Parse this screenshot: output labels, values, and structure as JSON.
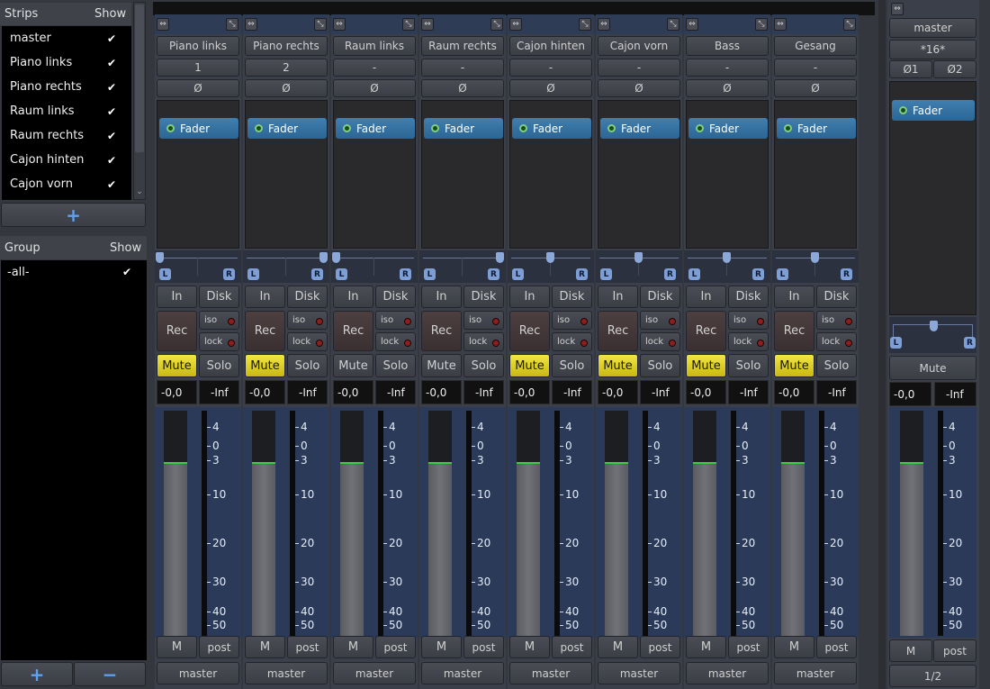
{
  "strips_panel": {
    "header": "Strips",
    "show_header": "Show",
    "items": [
      {
        "label": "master",
        "checked": true
      },
      {
        "label": "Piano links",
        "checked": true
      },
      {
        "label": "Piano rechts",
        "checked": true
      },
      {
        "label": "Raum links",
        "checked": true
      },
      {
        "label": "Raum rechts",
        "checked": true
      },
      {
        "label": "Cajon hinten",
        "checked": true
      },
      {
        "label": "Cajon vorn",
        "checked": true
      }
    ],
    "add": "+"
  },
  "group_panel": {
    "header": "Group",
    "show_header": "Show",
    "items": [
      {
        "label": "-all-",
        "checked": true
      }
    ],
    "add": "+",
    "remove": "−"
  },
  "check_glyph": "✔",
  "icons": {
    "width": "⇔",
    "shrink": "⤡"
  },
  "strips": [
    {
      "name": "Piano links",
      "input": "1",
      "phase": "Ø",
      "plugin": "Fader",
      "pan": -1,
      "in": "In",
      "disk": "Disk",
      "rec": "Rec",
      "iso": "iso",
      "lock": "lock",
      "mute": "Mute",
      "mute_active": true,
      "solo": "Solo",
      "gain": "-0,0",
      "peak": "-Inf",
      "meter_point": "post",
      "m": "M",
      "output": "master",
      "fader_level": 0.77
    },
    {
      "name": "Piano rechts",
      "input": "2",
      "phase": "Ø",
      "plugin": "Fader",
      "pan": 1,
      "in": "In",
      "disk": "Disk",
      "rec": "Rec",
      "iso": "iso",
      "lock": "lock",
      "mute": "Mute",
      "mute_active": true,
      "solo": "Solo",
      "gain": "-0,0",
      "peak": "-Inf",
      "meter_point": "post",
      "m": "M",
      "output": "master",
      "fader_level": 0.77
    },
    {
      "name": "Raum links",
      "input": "-",
      "phase": "Ø",
      "plugin": "Fader",
      "pan": -1,
      "in": "In",
      "disk": "Disk",
      "rec": "Rec",
      "iso": "iso",
      "lock": "lock",
      "mute": "Mute",
      "mute_active": false,
      "solo": "Solo",
      "gain": "-0,0",
      "peak": "-Inf",
      "meter_point": "post",
      "m": "M",
      "output": "master",
      "fader_level": 0.77
    },
    {
      "name": "Raum rechts",
      "input": "-",
      "phase": "Ø",
      "plugin": "Fader",
      "pan": 1,
      "in": "In",
      "disk": "Disk",
      "rec": "Rec",
      "iso": "iso",
      "lock": "lock",
      "mute": "Mute",
      "mute_active": false,
      "solo": "Solo",
      "gain": "-0,0",
      "peak": "-Inf",
      "meter_point": "post",
      "m": "M",
      "output": "master",
      "fader_level": 0.77
    },
    {
      "name": "Cajon hinten",
      "input": "-",
      "phase": "Ø",
      "plugin": "Fader",
      "pan": 0,
      "in": "In",
      "disk": "Disk",
      "rec": "Rec",
      "iso": "iso",
      "lock": "lock",
      "mute": "Mute",
      "mute_active": true,
      "solo": "Solo",
      "gain": "-0,0",
      "peak": "-Inf",
      "meter_point": "post",
      "m": "M",
      "output": "master",
      "fader_level": 0.77
    },
    {
      "name": "Cajon vorn",
      "input": "-",
      "phase": "Ø",
      "plugin": "Fader",
      "pan": 0,
      "in": "In",
      "disk": "Disk",
      "rec": "Rec",
      "iso": "iso",
      "lock": "lock",
      "mute": "Mute",
      "mute_active": true,
      "solo": "Solo",
      "gain": "-0,0",
      "peak": "-Inf",
      "meter_point": "post",
      "m": "M",
      "output": "master",
      "fader_level": 0.77
    },
    {
      "name": "Bass",
      "input": "-",
      "phase": "Ø",
      "plugin": "Fader",
      "pan": 0,
      "in": "In",
      "disk": "Disk",
      "rec": "Rec",
      "iso": "iso",
      "lock": "lock",
      "mute": "Mute",
      "mute_active": true,
      "solo": "Solo",
      "gain": "-0,0",
      "peak": "-Inf",
      "meter_point": "post",
      "m": "M",
      "output": "master",
      "fader_level": 0.77
    },
    {
      "name": "Gesang",
      "input": "-",
      "phase": "Ø",
      "plugin": "Fader",
      "pan": 0,
      "in": "In",
      "disk": "Disk",
      "rec": "Rec",
      "iso": "iso",
      "lock": "lock",
      "mute": "Mute",
      "mute_active": true,
      "solo": "Solo",
      "gain": "-0,0",
      "peak": "-Inf",
      "meter_point": "post",
      "m": "M",
      "output": "master",
      "fader_level": 0.77
    }
  ],
  "scale": [
    "4",
    "0",
    "3",
    "10",
    "20",
    "30",
    "40",
    "50"
  ],
  "master": {
    "name": "master",
    "input": "*16*",
    "phase1": "Ø1",
    "phase2": "Ø2",
    "plugin": "Fader",
    "pan": 0,
    "mute": "Mute",
    "gain": "-0,0",
    "peak": "-Inf",
    "m": "M",
    "meter_point": "post",
    "page": "1/2",
    "fader_level": 0.77
  },
  "colors": {
    "mute_active": "#e8dc2c",
    "plugin": "#2f6d9c",
    "strip_bg": "#3b3f4a",
    "meter_bg": "#2a3a58"
  }
}
